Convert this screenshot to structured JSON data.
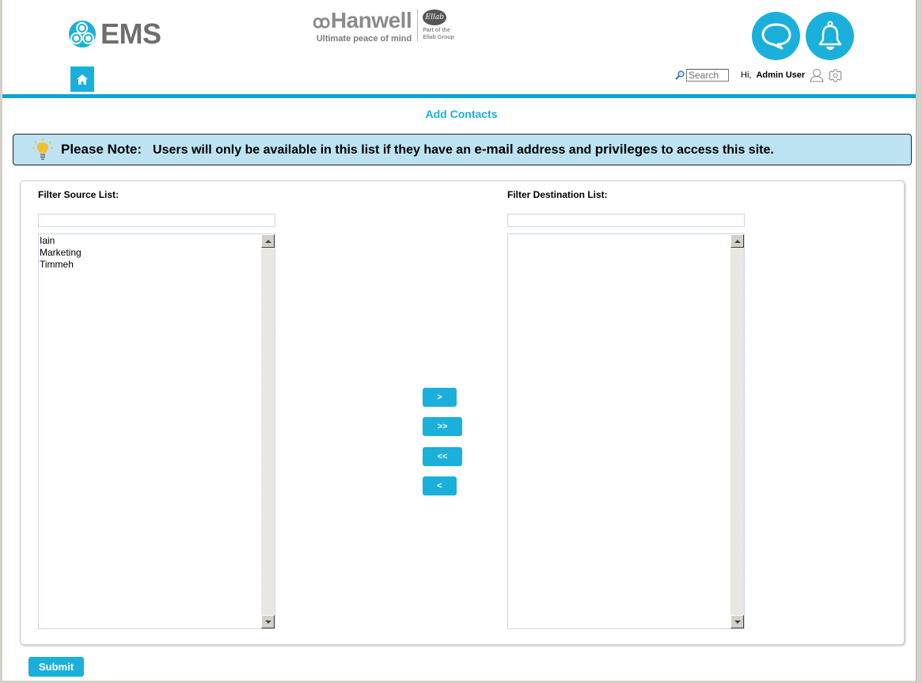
{
  "header": {
    "app_logo_text": "EMS",
    "brand_name": "Hanwell",
    "brand_dots": "ꝏ",
    "brand_tagline": "Ultimate peace of mind",
    "partner_mark": "Ellab",
    "partner_text_line1": "Part of the",
    "partner_text_line2": "Ellab Group",
    "accent_color": "#1ab0db"
  },
  "nav": {
    "home_icon": "home-icon",
    "search_placeholder": "Search",
    "search_value": "",
    "greeting": "Hi,",
    "username": "Admin User",
    "user_icon": "user-icon",
    "settings_icon": "gear-icon",
    "chat_icon": "chat-bubble-icon",
    "notification_icon": "bell-icon"
  },
  "page": {
    "title": "Add Contacts"
  },
  "note": {
    "icon": "lightbulb-icon",
    "label": "Please Note:",
    "message_parts": {
      "p1": "Users will only be available in this list if they have an ",
      "b1": "e-mail",
      "p2": " address and ",
      "b2": "privileges",
      "p3": " to access this site."
    }
  },
  "source": {
    "label": "Filter Source List:",
    "filter_value": "",
    "items": [
      "Iain",
      "Marketing",
      "Timmeh"
    ]
  },
  "destination": {
    "label": "Filter Destination List:",
    "filter_value": "",
    "items": []
  },
  "transfer_buttons": {
    "move_selected_right": ">",
    "move_all_right": ">>",
    "move_all_left": "<<",
    "move_selected_left": "<"
  },
  "actions": {
    "submit_label": "Submit"
  }
}
